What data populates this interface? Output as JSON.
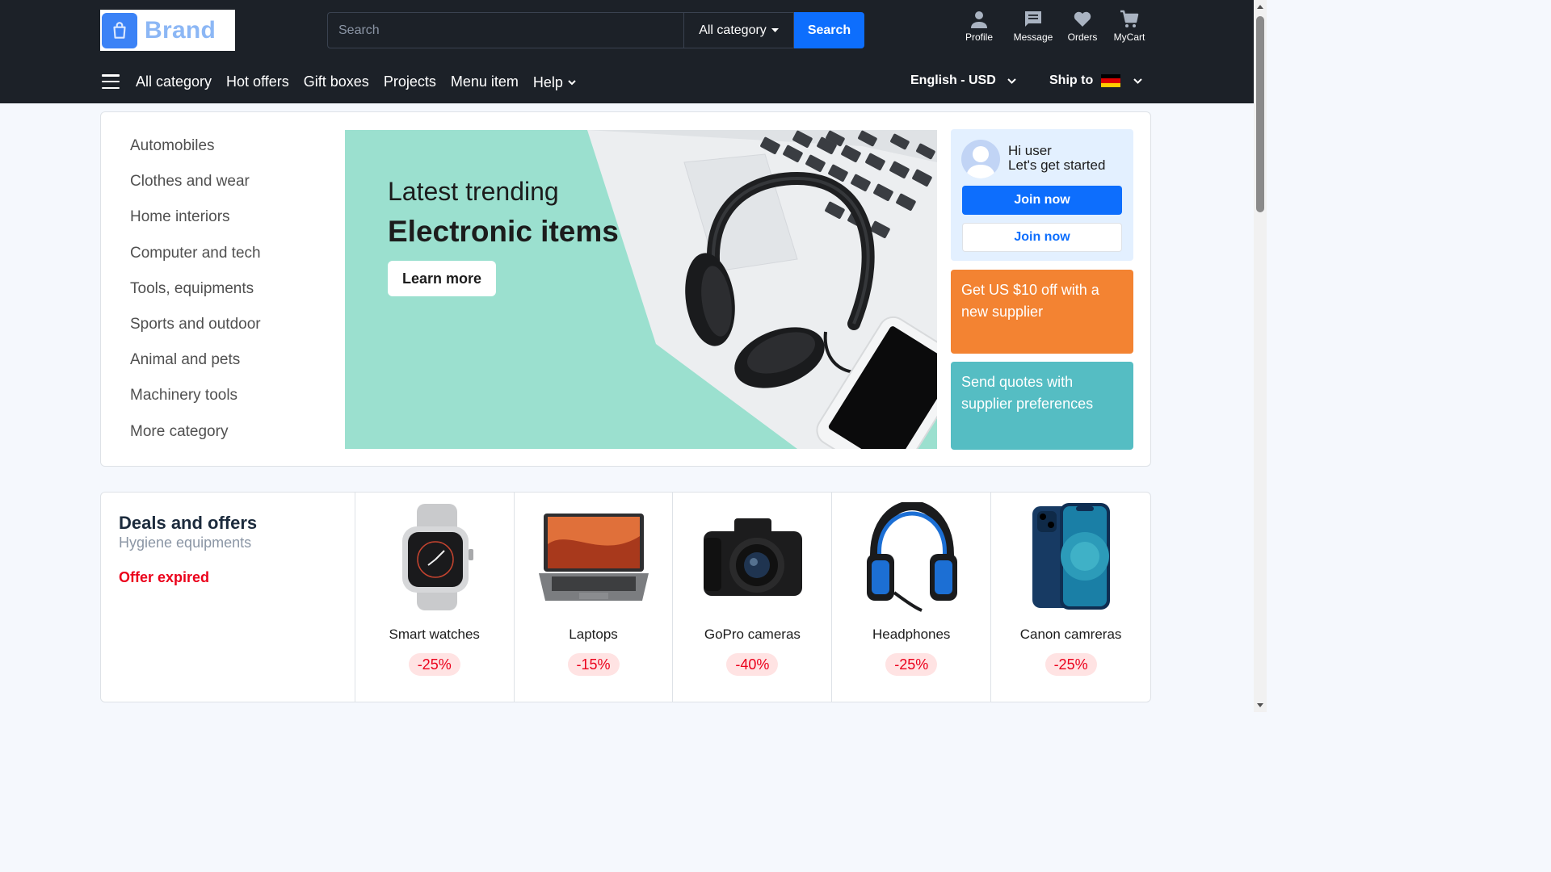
{
  "brand": {
    "name": "Brand",
    "icon": "shopping-bag-icon",
    "color": "#8cb7f5"
  },
  "search": {
    "placeholder": "Search",
    "category": "All category",
    "button": "Search"
  },
  "actions": [
    {
      "label": "Profile",
      "icon": "person-icon"
    },
    {
      "label": "Message",
      "icon": "message-icon"
    },
    {
      "label": "Orders",
      "icon": "heart-icon"
    },
    {
      "label": "MyCart",
      "icon": "cart-icon"
    }
  ],
  "nav": {
    "links": [
      "All category",
      "Hot offers",
      "Gift boxes",
      "Projects",
      "Menu item"
    ],
    "help": "Help",
    "language": "English - USD",
    "ship_to": "Ship to",
    "ship_flag": "germany-flag-icon"
  },
  "categories": [
    "Automobiles",
    "Clothes and wear",
    "Home interiors",
    "Computer and tech",
    "Tools, equipments",
    "Sports and outdoor",
    "Animal and pets",
    "Machinery tools",
    "More category"
  ],
  "banner": {
    "line1": "Latest trending",
    "line2": "Electronic items",
    "button": "Learn more",
    "bg": "#9be0cf"
  },
  "user_card": {
    "greeting": "Hi user",
    "subtitle": "Let's get started",
    "primary_button": "Join now",
    "secondary_button": "Join now"
  },
  "promos": [
    {
      "text": "Get US $10 off with a new supplier",
      "color": "#f38332"
    },
    {
      "text": "Send quotes with supplier preferences",
      "color": "#55bdc3"
    }
  ],
  "deals": {
    "title": "Deals and offers",
    "subtitle": "Hygiene equipments",
    "status": "Offer expired",
    "items": [
      {
        "name": "Smart watches",
        "discount": "-25%",
        "icon": "smartwatch-icon"
      },
      {
        "name": "Laptops",
        "discount": "-15%",
        "icon": "laptop-icon"
      },
      {
        "name": "GoPro cameras",
        "discount": "-40%",
        "icon": "camera-icon"
      },
      {
        "name": "Headphones",
        "discount": "-25%",
        "icon": "headphones-icon"
      },
      {
        "name": "Canon camreras",
        "discount": "-25%",
        "icon": "smartphone-icon"
      }
    ]
  },
  "colors": {
    "header": "#1c2128",
    "accent": "#0d6efd",
    "discount": "#eb001b"
  }
}
